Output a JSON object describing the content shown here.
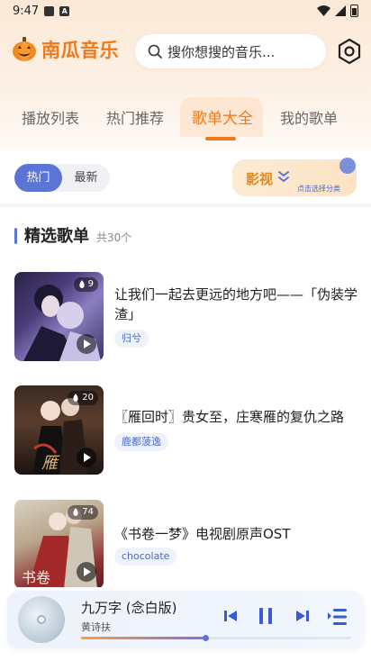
{
  "status_bar": {
    "time": "9:47"
  },
  "app": {
    "name": "南瓜音乐"
  },
  "search": {
    "placeholder": "搜你想搜的音乐..."
  },
  "tabs": [
    {
      "label": "播放列表",
      "active": false
    },
    {
      "label": "热门推荐",
      "active": false
    },
    {
      "label": "歌单大全",
      "active": true
    },
    {
      "label": "我的歌单",
      "active": false
    }
  ],
  "filter": {
    "options": [
      "热门",
      "最新"
    ],
    "selected": "热门",
    "category": {
      "label": "影视",
      "hint": "点击选择分类"
    }
  },
  "section": {
    "title": "精选歌单",
    "count": "共30个"
  },
  "playlists": [
    {
      "title": "让我们一起去更远的地方吧——「伪装学渣」",
      "tag": "归兮",
      "heat": "9"
    },
    {
      "title": "〖雁回时〗贵女至，庄寒雁的复仇之路",
      "tag": "鹿都菠逸",
      "heat": "20"
    },
    {
      "title": "《书卷一梦》电视剧原声OST",
      "tag": "chocolate",
      "heat": "74"
    }
  ],
  "player": {
    "song_title": "九万字 (念白版)",
    "artist": "黄诗扶",
    "progress": 0.46
  },
  "colors": {
    "accent_orange": "#f07a1a",
    "accent_blue": "#5b75d6",
    "tag_blue": "#4d69c6"
  }
}
